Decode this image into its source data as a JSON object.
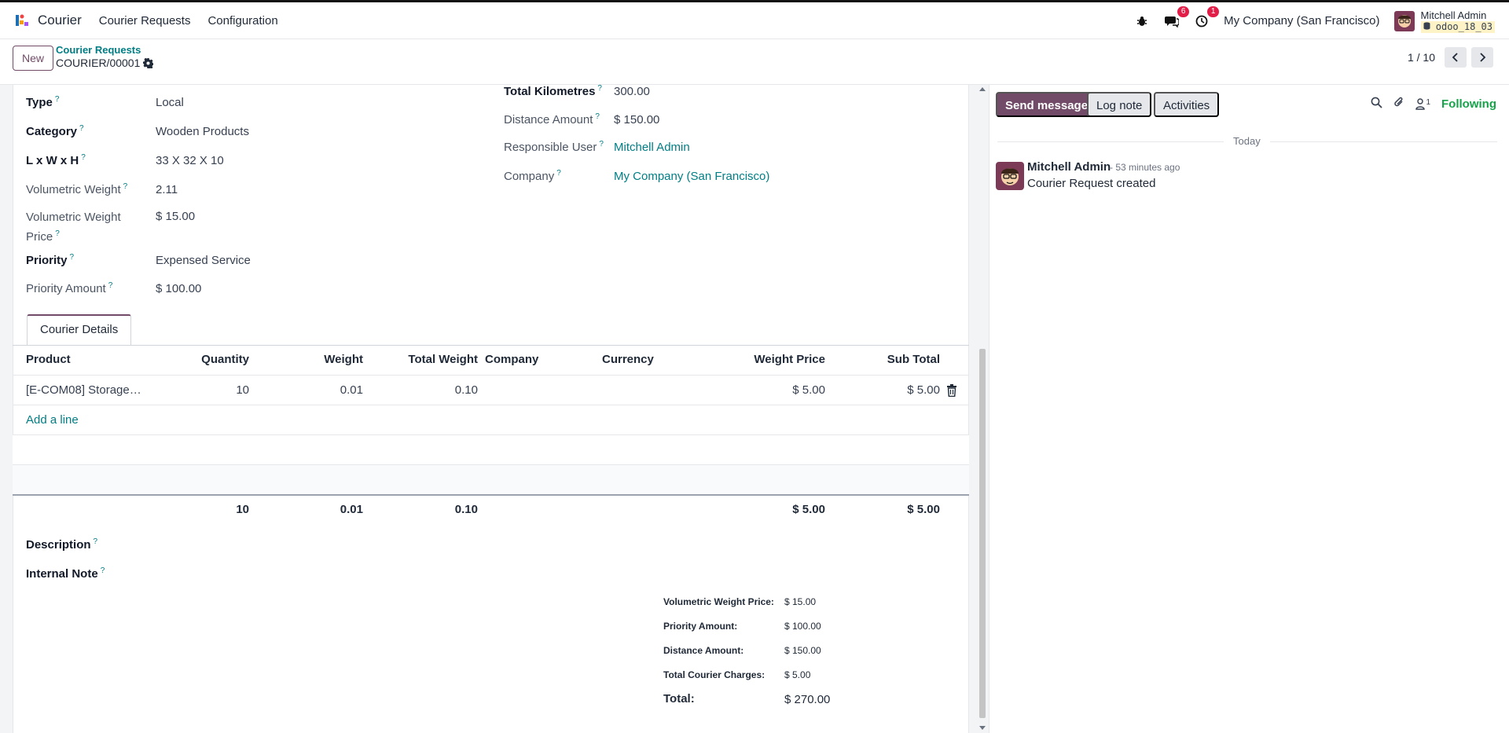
{
  "topbar": {
    "app_name": "Courier",
    "menu": [
      "Courier Requests",
      "Configuration"
    ],
    "messages_count": "6",
    "activities_count": "1",
    "company": "My Company (San Francisco)",
    "user_name": "Mitchell Admin",
    "db_name": "odoo_18_03"
  },
  "control": {
    "new_label": "New",
    "breadcrumb_parent": "Courier Requests",
    "breadcrumb_current": "COURIER/00001",
    "pager": "1 / 10"
  },
  "form": {
    "left": [
      {
        "label": "Type",
        "value": "Local",
        "bold": true
      },
      {
        "label": "Category",
        "value": "Wooden Products",
        "bold": true
      },
      {
        "label": "L x W x H",
        "value": "33 X 32 X 10",
        "bold": true
      },
      {
        "label": "Volumetric Weight",
        "value": "2.11",
        "bold": false
      },
      {
        "label_line1": "Volumetric Weight",
        "label_line2": "Price",
        "value": "$ 15.00",
        "bold": false
      },
      {
        "label": "Priority",
        "value": "Expensed Service",
        "bold": true
      },
      {
        "label": "Priority Amount",
        "value": "$ 100.00",
        "bold": false
      }
    ],
    "right": [
      {
        "label": "Total Kilometres",
        "value": "300.00",
        "bold": true
      },
      {
        "label": "Distance Amount",
        "value": "$ 150.00",
        "bold": false
      },
      {
        "label": "Responsible User",
        "value": "Mitchell Admin",
        "bold": false,
        "link": true
      },
      {
        "label": "Company",
        "value": "My Company (San Francisco)",
        "bold": false,
        "link": true
      }
    ],
    "help_mark": "?"
  },
  "tabs": [
    "Courier Details"
  ],
  "table": {
    "headers": [
      "Product",
      "Quantity",
      "Weight",
      "Total Weight",
      "Company",
      "Currency",
      "Weight Price",
      "Sub Total"
    ],
    "rows": [
      {
        "product": "[E-COM08] Storage…",
        "quantity": "10",
        "weight": "0.01",
        "total_weight": "0.10",
        "company": "",
        "currency": "",
        "weight_price": "$ 5.00",
        "sub_total": "$ 5.00"
      }
    ],
    "add_line": "Add a line",
    "totals": {
      "quantity": "10",
      "weight": "0.01",
      "total_weight": "0.10",
      "weight_price": "$ 5.00",
      "sub_total": "$ 5.00"
    }
  },
  "notes": {
    "description_label": "Description",
    "internal_note_label": "Internal Note"
  },
  "summary": [
    {
      "label": "Volumetric Weight Price:",
      "value": "$ 15.00"
    },
    {
      "label": "Priority Amount:",
      "value": "$ 100.00"
    },
    {
      "label": "Distance Amount:",
      "value": "$ 150.00"
    },
    {
      "label": "Total Courier Charges:",
      "value": "$ 5.00"
    }
  ],
  "summary_total": {
    "label": "Total:",
    "value": "$ 270.00"
  },
  "chatter": {
    "send_message": "Send message",
    "log_note": "Log note",
    "activities": "Activities",
    "followers_count": "1",
    "following": "Following",
    "date_separator": "Today",
    "messages": [
      {
        "author": "Mitchell Admin",
        "time": "- 53 minutes ago",
        "body": "Courier Request created"
      }
    ]
  },
  "colors": {
    "brand": "#714b67",
    "link": "#017e84",
    "badge": "#e11d48",
    "following": "#16a34a"
  }
}
